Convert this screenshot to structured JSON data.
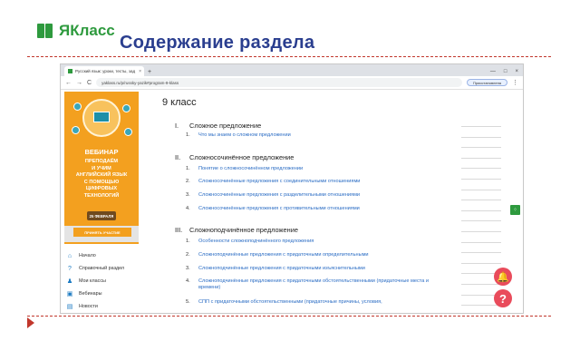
{
  "slide": {
    "logo_text": "ЯКласс",
    "title": "Содержание раздела"
  },
  "browser": {
    "tab_title": "Русский язык: уроки, тесты, зад",
    "tab_close": "×",
    "tab_new": "+",
    "win_minimize": "—",
    "win_maximize": "□",
    "win_close": "×",
    "back": "←",
    "forward": "→",
    "reload": "C",
    "url": "yaklass.ru/p/russky-yazik#program-9-klass",
    "profile_pill": "Приостановлена",
    "menu": "⋮"
  },
  "sidebar": {
    "banner": {
      "title": "ВЕБИНАР",
      "lines": [
        "ПРЕПОДАЁМ",
        "И УЧИМ",
        "АНГЛИЙСКИЙ ЯЗЫК",
        "С ПОМОЩЬЮ",
        "ЦИФРОВЫХ",
        "ТЕХНОЛОГИЙ"
      ],
      "date": "25 ФЕВРАЛЯ",
      "button": "ПРИНЯТЬ УЧАСТИЕ"
    },
    "nav": [
      {
        "icon": "home-icon",
        "glyph": "⌂",
        "label": "Начало"
      },
      {
        "icon": "help-icon",
        "glyph": "?",
        "label": "Справочный раздел"
      },
      {
        "icon": "people-icon",
        "glyph": "♟",
        "label": "Мои классы"
      },
      {
        "icon": "webinar-icon",
        "glyph": "▣",
        "label": "Вебинары"
      },
      {
        "icon": "news-icon",
        "glyph": "▤",
        "label": "Новости"
      }
    ]
  },
  "main": {
    "grade": "9 класс",
    "sections": [
      {
        "num": "I.",
        "title": "Сложное предложение",
        "items": [
          {
            "n": "1.",
            "text": "Что мы знаем о сложном предложении"
          }
        ]
      },
      {
        "num": "II.",
        "title": "Сложносочинённое предложение",
        "items": [
          {
            "n": "1.",
            "text": "Понятие о сложносочинённом предложении"
          },
          {
            "n": "2.",
            "text": "Сложносочинённые предложения с соединительными отношениями"
          },
          {
            "n": "3.",
            "text": "Сложносочинённые предложения с разделительными отношениями"
          },
          {
            "n": "4.",
            "text": "Сложносочинённые предложения с противительными отношениями"
          }
        ]
      },
      {
        "num": "III.",
        "title": "Сложноподчинённое предложение",
        "items": [
          {
            "n": "1.",
            "text": "Особенности сложноподчинённого предложения"
          },
          {
            "n": "2.",
            "text": "Сложноподчинённые предложения с придаточными определительными"
          },
          {
            "n": "3.",
            "text": "Сложноподчинённые предложения с придаточными изъяснительными"
          },
          {
            "n": "4.",
            "text": "Сложноподчинённые предложения с придаточными обстоятельственными (придаточные места и времени)"
          },
          {
            "n": "5.",
            "text": "СПП с придаточными обстоятельственными (придаточные причины, условия,"
          }
        ]
      }
    ]
  },
  "widgets": {
    "bell_glyph": "🔔",
    "help_glyph": "?",
    "expand_glyph": "⁘"
  },
  "colors": {
    "title": "#2a3e8f",
    "link": "#2a6cc4",
    "banner": "#f3a01f",
    "brand_green": "#2e9a3e",
    "accent_red": "#e94b5b",
    "rule": "#c1372c"
  }
}
